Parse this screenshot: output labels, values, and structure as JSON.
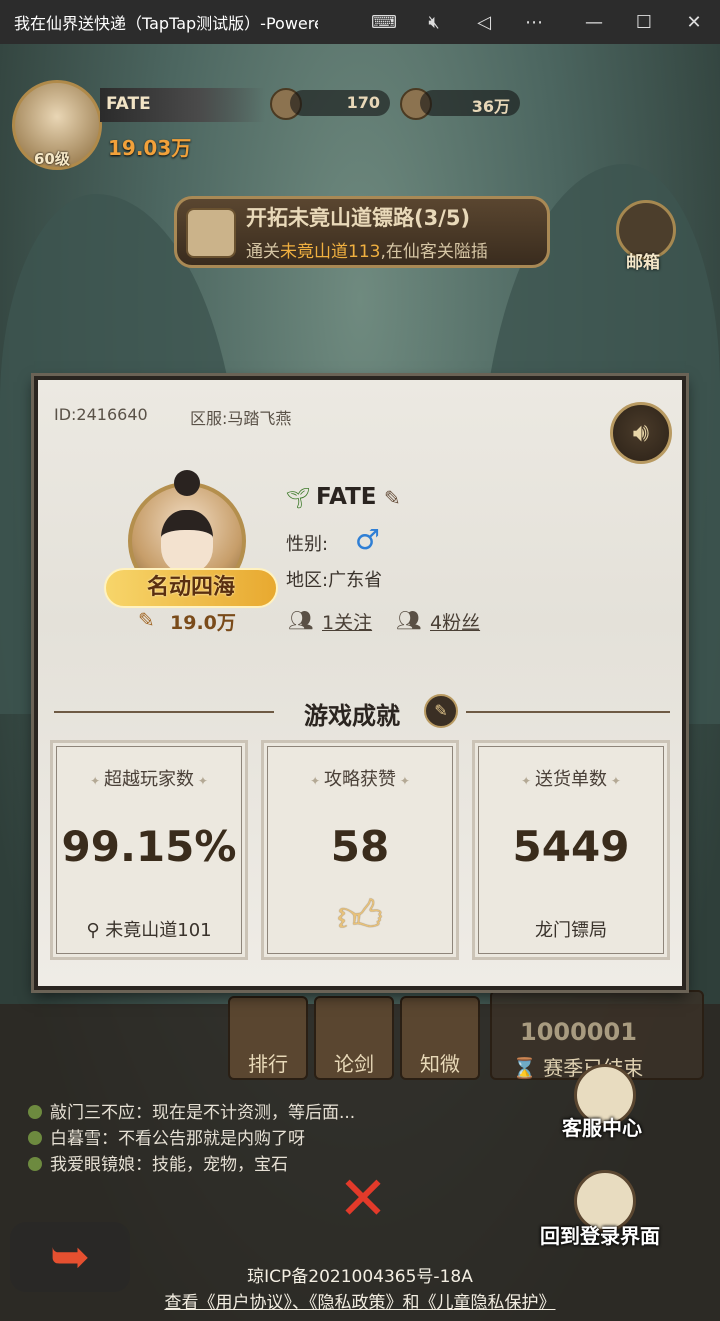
{
  "window": {
    "title": "我在仙界送快递（TapTap测试版）-Powere",
    "buttons": [
      "keyboard-icon",
      "mute-icon",
      "back-triangle-icon",
      "more-icon",
      "minimize-icon",
      "maximize-icon",
      "close-icon"
    ]
  },
  "hud": {
    "name": "FATE",
    "level": "60级",
    "power": "19.03万",
    "stone": "170",
    "coins": "36万",
    "quest_title": "开拓未竟山道镖路(3/5)",
    "quest_sub_prefix": "通关",
    "quest_sub_highlight": "未竟山道113",
    "quest_sub_suffix": ",在仙客关隘插",
    "mail": "邮箱"
  },
  "bottom": {
    "rank": "排行",
    "duel": "论剑",
    "zhiwei": "知微",
    "season": "赛季已结束",
    "season_num": "1000001",
    "chat": [
      "敲门三不应：现在是不计资测，等后面...",
      "白暮雪：不看公告那就是内购了呀",
      "我爱眼镜娘：技能，宠物，宝石"
    ],
    "service": "客服中心",
    "back_login": "回到登录界面",
    "icp": "琼ICP备2021004365号-18A",
    "links": "查看《用户协议》、《隐私政策》和《儿童隐私保护》"
  },
  "profile": {
    "id": "ID:2416640",
    "server": "区服:马踏飞燕",
    "name": "FATE",
    "gender_label": "性别:",
    "gender": "♂",
    "region_label": "地区:",
    "region": "广东省",
    "title_badge": "名动四海",
    "power": "19.0万",
    "following": "1关注",
    "fans": "4粉丝",
    "section": "游戏成就",
    "stats": [
      {
        "label": "超越玩家数",
        "value": "99.15%",
        "foot": "未竟山道101"
      },
      {
        "label": "攻略获赞",
        "value": "58",
        "foot": ""
      },
      {
        "label": "送货单数",
        "value": "5449",
        "foot": "龙门镖局"
      }
    ]
  },
  "colors": {
    "accent_gold": "#b89a62",
    "power_orange": "#f2a13a",
    "gender_blue": "#2f7fd5",
    "close_red": "#e23a2a"
  }
}
